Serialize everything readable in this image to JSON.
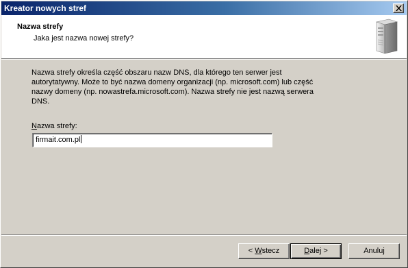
{
  "window": {
    "title": "Kreator nowych stref",
    "close_glyph": "×"
  },
  "header": {
    "title": "Nazwa strefy",
    "subtitle": "Jaka jest nazwa nowej strefy?",
    "icon": "server-tower-icon"
  },
  "content": {
    "description_line1": "Nazwa strefy określa część obszaru nazw DNS, dla którego ten serwer jest",
    "description_line2": "autorytatywny. Może to być nazwa domeny organizacji (np. microsoft.com) lub część",
    "description_line3": "nazwy domeny (np. nowastrefa.microsoft.com). Nazwa strefy nie jest nazwą serwera",
    "description_line4": "DNS.",
    "zone_label_accel": "N",
    "zone_label_rest": "azwa strefy:",
    "zone_value": "firmait.com.pl"
  },
  "buttons": {
    "back_prefix": "< ",
    "back_accel": "W",
    "back_rest": "stecz",
    "next_accel": "D",
    "next_rest": "alej >",
    "cancel": "Anuluj"
  },
  "colors": {
    "title_gradient_start": "#0a246a",
    "title_gradient_end": "#a6caf0",
    "dialog_face": "#d4d0c8"
  }
}
